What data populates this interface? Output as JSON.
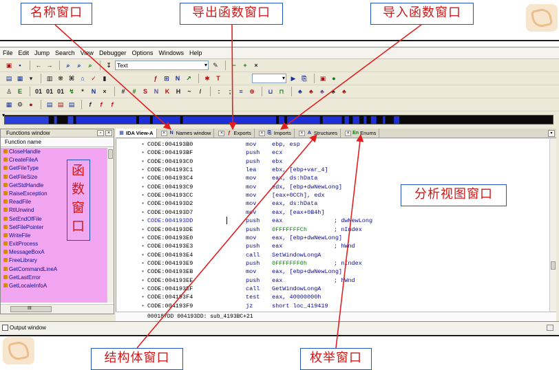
{
  "callouts": {
    "names": "名称窗口",
    "exports": "导出函数窗口",
    "imports": "导入函数窗口",
    "functions": "函数窗口",
    "analysis": "分析视图窗口",
    "structures": "结构体窗口",
    "enums": "枚举窗口"
  },
  "colors": {
    "callout_text": "#d01818",
    "callout_border": "#1e55b6",
    "arrow": "#e02020",
    "function_list_bg": "#f2a6f2",
    "nav_code_blue": "#1f2fd8"
  },
  "menu": [
    "File",
    "Edit",
    "Jump",
    "Search",
    "View",
    "Debugger",
    "Options",
    "Windows",
    "Help"
  ],
  "toolbar": {
    "display_combo": "Text"
  },
  "functions_pane": {
    "title": "Functions window",
    "header": "Function name",
    "items": [
      "CloseHandle",
      "CreateFileA",
      "GetFileType",
      "GetFileSize",
      "GetStdHandle",
      "RaiseException",
      "ReadFile",
      "RtlUnwind",
      "SetEndOfFile",
      "SetFilePointer",
      "WriteFile",
      "ExitProcess",
      "MessageBoxA",
      "FreeLibrary",
      "GetCommandLineA",
      "GetLastError",
      "GetLocaleInfoA"
    ],
    "scroll_label": "III"
  },
  "tabs": [
    {
      "label": "IDA View-A",
      "icon": "view-icon",
      "active": true
    },
    {
      "label": "Names window",
      "icon": "names-icon",
      "active": false
    },
    {
      "label": "Exports",
      "icon": "exports-icon",
      "active": false
    },
    {
      "label": "Imports",
      "icon": "imports-icon",
      "active": false
    },
    {
      "label": "Structures",
      "icon": "structures-icon",
      "active": false
    },
    {
      "label": "Enums",
      "icon": "enums-icon",
      "active": false
    }
  ],
  "disassembly": [
    {
      "addr": "CODE:004193B0",
      "mnem": "mov",
      "ops": "ebp, esp",
      "comment": ""
    },
    {
      "addr": "CODE:004193BF",
      "mnem": "push",
      "ops": "ecx",
      "comment": ""
    },
    {
      "addr": "CODE:004193C0",
      "mnem": "push",
      "ops": "ebx",
      "comment": ""
    },
    {
      "addr": "CODE:004193C1",
      "mnem": "lea",
      "ops": "ebx, [ebp+var_4]",
      "comment": ""
    },
    {
      "addr": "CODE:004193C4",
      "mnem": "mov",
      "ops": "eax, ds:hData",
      "comment": ""
    },
    {
      "addr": "CODE:004193C9",
      "mnem": "mov",
      "ops": "edx, [ebp+dwNewLong]",
      "comment": ""
    },
    {
      "addr": "CODE:004193CC",
      "mnem": "mov",
      "ops": "[eax+0CCh], edx",
      "comment": ""
    },
    {
      "addr": "CODE:004193D2",
      "mnem": "mov",
      "ops": "eax, ds:hData",
      "comment": ""
    },
    {
      "addr": "CODE:004193D7",
      "mnem": "mov",
      "ops": "eax, [eax+0B4h]",
      "comment": ""
    },
    {
      "addr": "CODE:004193DD",
      "mnem": "push",
      "ops": "eax",
      "comment": "; dwNewLong"
    },
    {
      "addr": "CODE:004193DE",
      "mnem": "push",
      "ops": "0FFFFFFFCh",
      "comment": "; nIndex"
    },
    {
      "addr": "CODE:004193E0",
      "mnem": "mov",
      "ops": "eax, [ebp+dwNewLong]",
      "comment": ""
    },
    {
      "addr": "CODE:004193E3",
      "mnem": "push",
      "ops": "eax",
      "comment": "; hWnd"
    },
    {
      "addr": "CODE:004193E4",
      "mnem": "call",
      "ops": "SetWindowLongA",
      "comment": ""
    },
    {
      "addr": "CODE:004193E9",
      "mnem": "push",
      "ops": "0FFFFFFF0h",
      "comment": "; nIndex"
    },
    {
      "addr": "CODE:004193EB",
      "mnem": "mov",
      "ops": "eax, [ebp+dwNewLong]",
      "comment": ""
    },
    {
      "addr": "CODE:004193EE",
      "mnem": "push",
      "ops": "eax",
      "comment": "; hWnd"
    },
    {
      "addr": "CODE:004193EF",
      "mnem": "call",
      "ops": "GetWindowLongA",
      "comment": ""
    },
    {
      "addr": "CODE:004193F4",
      "mnem": "test",
      "ops": "eax, 40000000h",
      "comment": ""
    },
    {
      "addr": "CODE:004193F9",
      "mnem": "jz",
      "ops": "short loc_419419",
      "comment": ""
    }
  ],
  "status_bar": "000187DD  004193DD: sub_4193BC+21",
  "output_window": "Output window"
}
